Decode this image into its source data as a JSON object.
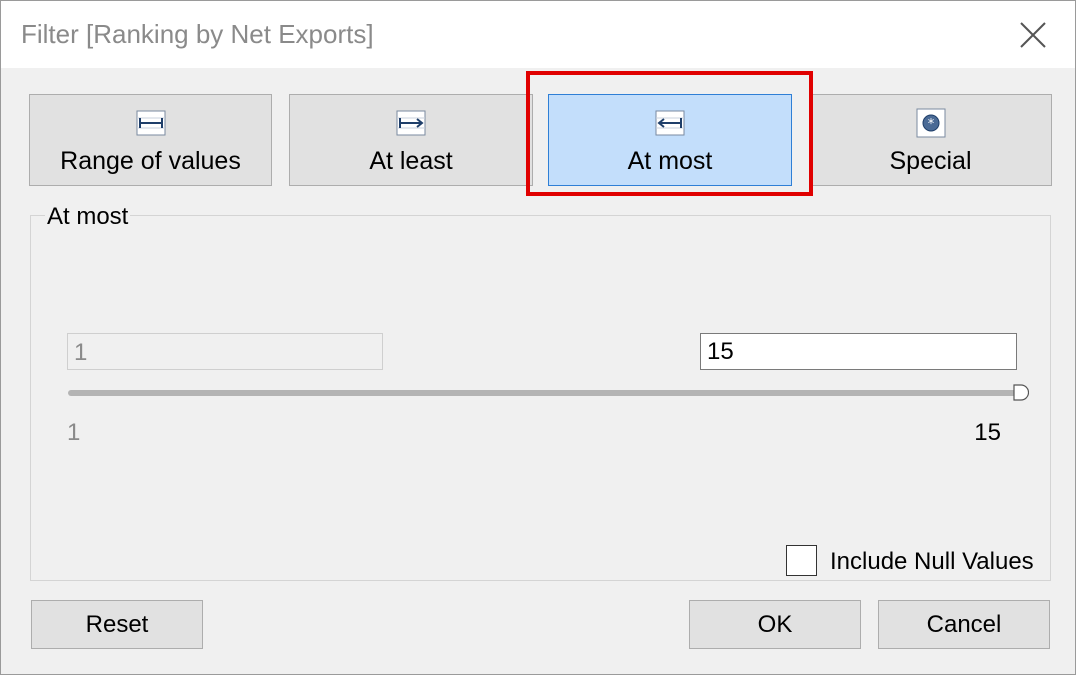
{
  "dialog": {
    "title": "Filter [Ranking by Net Exports]"
  },
  "modes": [
    {
      "label": "Range of values",
      "icon": "range-icon",
      "active": false
    },
    {
      "label": "At least",
      "icon": "at-least-icon",
      "active": false
    },
    {
      "label": "At most",
      "icon": "at-most-icon",
      "active": true
    },
    {
      "label": "Special",
      "icon": "special-icon",
      "active": false
    }
  ],
  "panel": {
    "label": "At most",
    "min_value": "1",
    "max_value": "15",
    "range_min_label": "1",
    "range_max_label": "15",
    "include_null_label": "Include Null Values",
    "include_null_checked": false
  },
  "buttons": {
    "reset": "Reset",
    "ok": "OK",
    "cancel": "Cancel"
  },
  "colors": {
    "active_mode_bg": "#c3defb",
    "active_mode_border": "#2f7fd6",
    "highlight": "#e00000"
  }
}
